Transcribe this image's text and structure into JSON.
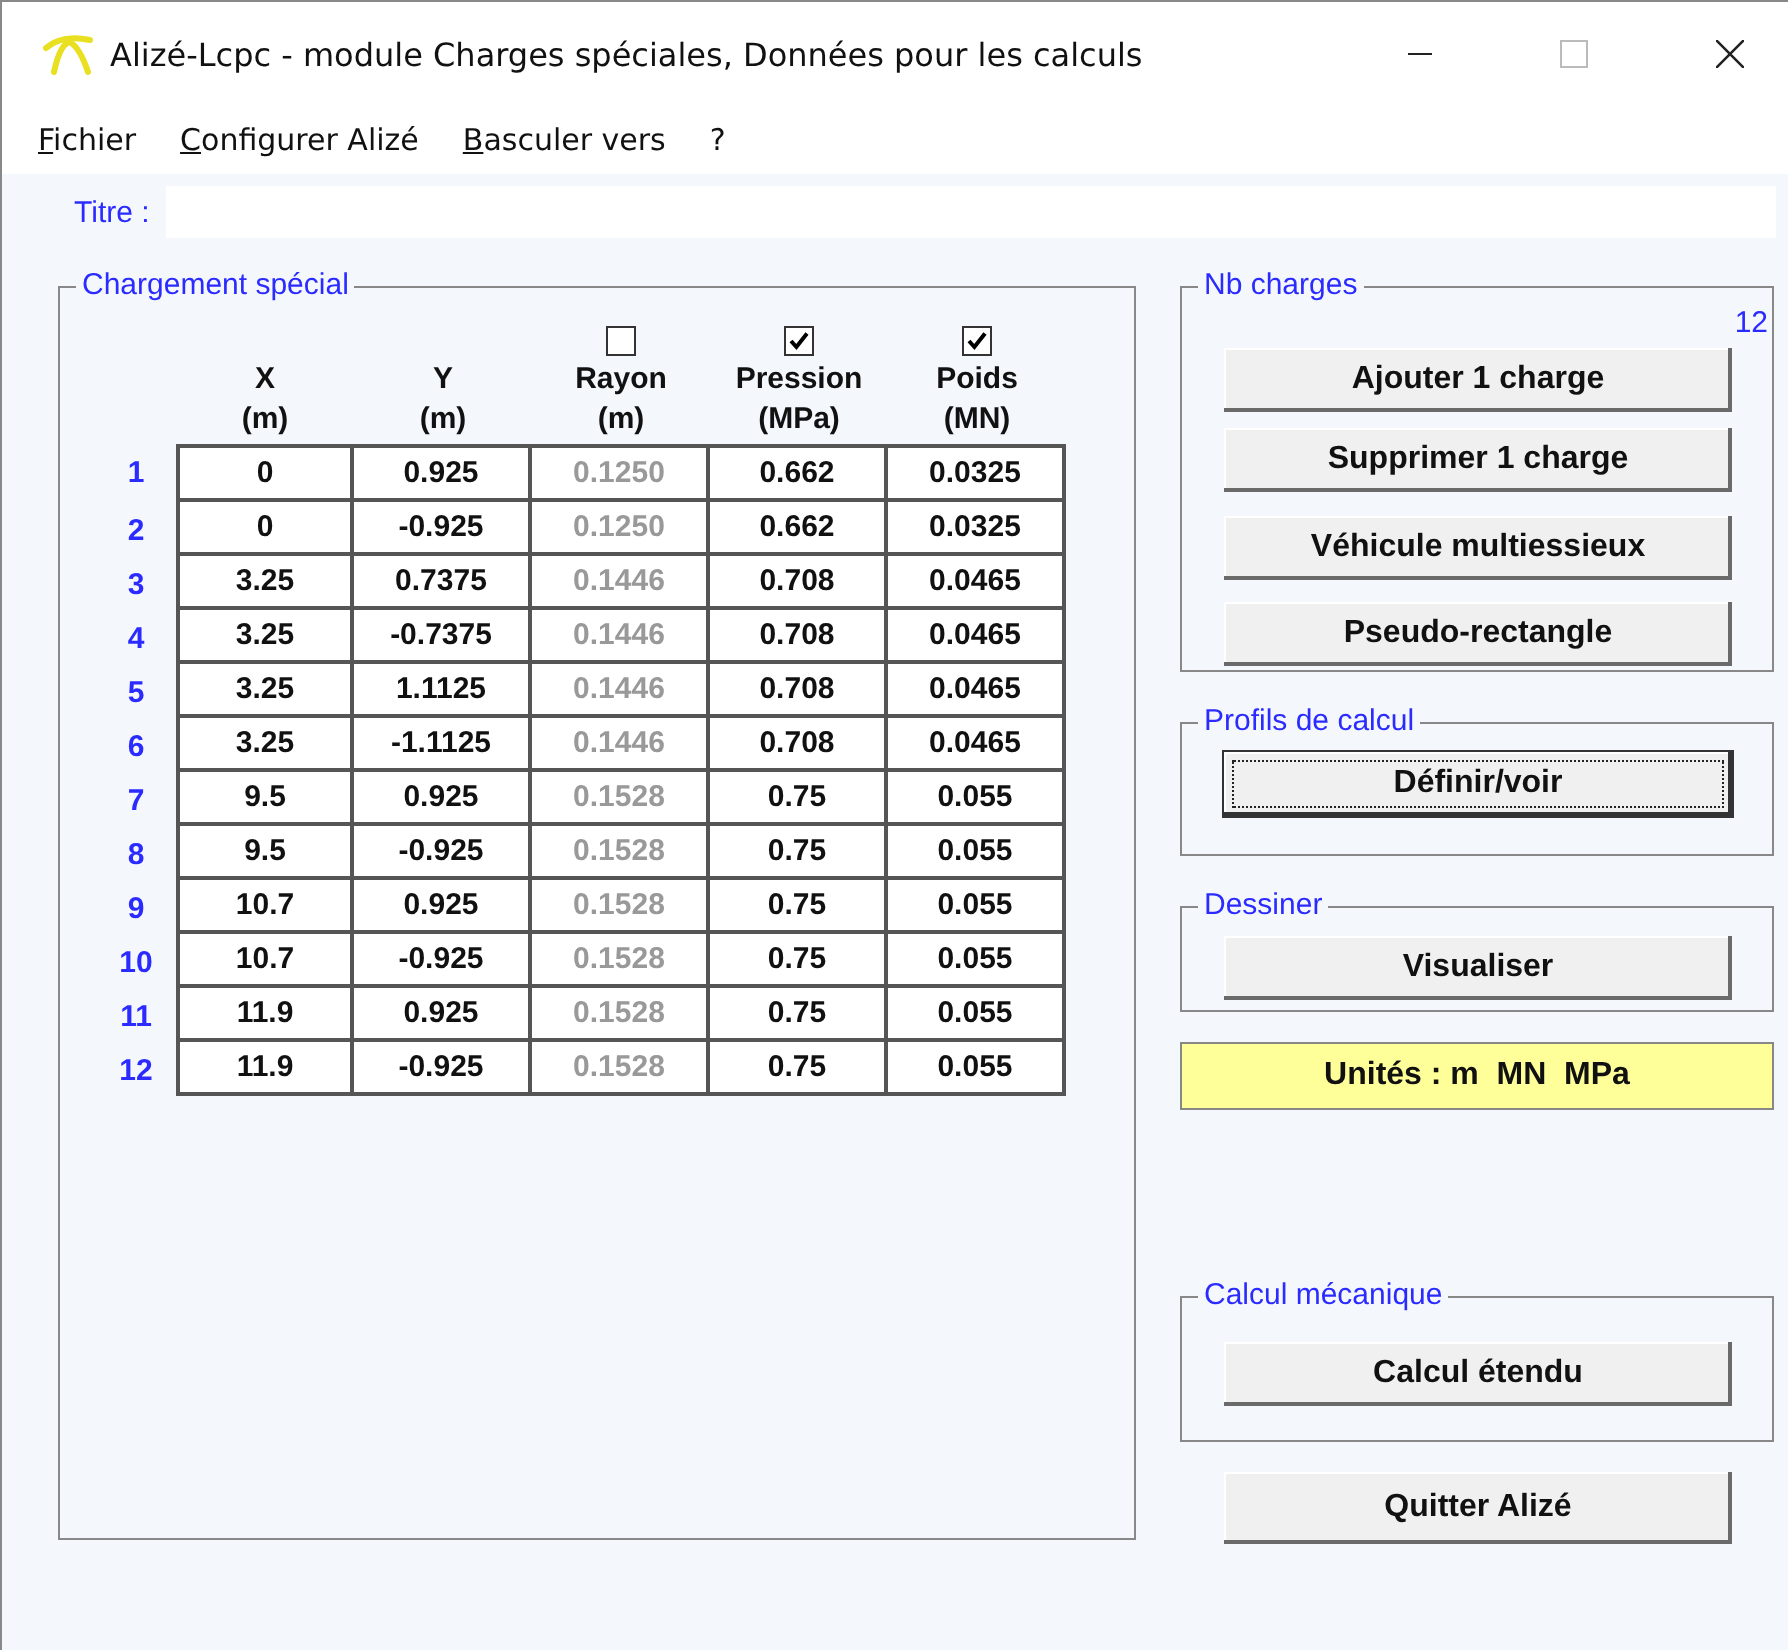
{
  "window": {
    "title": "Alizé-Lcpc - module Charges spéciales, Données pour les calculs"
  },
  "menu": [
    {
      "label": "Fichier",
      "mnemonic": true
    },
    {
      "label": "Configurer Alizé",
      "mnemonic": true
    },
    {
      "label": "Basculer vers",
      "mnemonic": true
    },
    {
      "label": "?",
      "mnemonic": false
    }
  ],
  "titre": {
    "label": "Titre :"
  },
  "chargement": {
    "legend": "Chargement spécial",
    "columns": [
      {
        "name": "X",
        "unit": "(m)"
      },
      {
        "name": "Y",
        "unit": "(m)"
      },
      {
        "name": "Rayon",
        "unit": "(m)",
        "checked": false
      },
      {
        "name": "Pression",
        "unit": "(MPa)",
        "checked": true
      },
      {
        "name": "Poids",
        "unit": "(MN)",
        "checked": true
      }
    ],
    "rows": [
      {
        "index": "1",
        "cells": [
          "0",
          "0.925",
          "0.1250",
          "0.662",
          "0.0325"
        ]
      },
      {
        "index": "2",
        "cells": [
          "0",
          "-0.925",
          "0.1250",
          "0.662",
          "0.0325"
        ]
      },
      {
        "index": "3",
        "cells": [
          "3.25",
          "0.7375",
          "0.1446",
          "0.708",
          "0.0465"
        ]
      },
      {
        "index": "4",
        "cells": [
          "3.25",
          "-0.7375",
          "0.1446",
          "0.708",
          "0.0465"
        ]
      },
      {
        "index": "5",
        "cells": [
          "3.25",
          "1.1125",
          "0.1446",
          "0.708",
          "0.0465"
        ]
      },
      {
        "index": "6",
        "cells": [
          "3.25",
          "-1.1125",
          "0.1446",
          "0.708",
          "0.0465"
        ]
      },
      {
        "index": "7",
        "cells": [
          "9.5",
          "0.925",
          "0.1528",
          "0.75",
          "0.055"
        ]
      },
      {
        "index": "8",
        "cells": [
          "9.5",
          "-0.925",
          "0.1528",
          "0.75",
          "0.055"
        ]
      },
      {
        "index": "9",
        "cells": [
          "10.7",
          "0.925",
          "0.1528",
          "0.75",
          "0.055"
        ]
      },
      {
        "index": "10",
        "cells": [
          "10.7",
          "-0.925",
          "0.1528",
          "0.75",
          "0.055"
        ]
      },
      {
        "index": "11",
        "cells": [
          "11.9",
          "0.925",
          "0.1528",
          "0.75",
          "0.055"
        ]
      },
      {
        "index": "12",
        "cells": [
          "11.9",
          "-0.925",
          "0.1528",
          "0.75",
          "0.055"
        ]
      }
    ]
  },
  "nb_charges": {
    "legend": "Nb charges",
    "count": "12",
    "buttons": [
      {
        "label": "Ajouter 1 charge",
        "focused": false
      },
      {
        "label": "Supprimer 1 charge",
        "focused": false
      },
      {
        "label": "Véhicule multiessieux",
        "focused": false
      },
      {
        "label": "Pseudo-rectangle",
        "focused": false
      }
    ]
  },
  "profils": {
    "legend": "Profils de calcul",
    "button": {
      "label": "Définir/voir",
      "focused": true
    }
  },
  "dessiner": {
    "legend": "Dessiner",
    "button": {
      "label": "Visualiser",
      "focused": false
    }
  },
  "unites": "Unités : m  MN  MPa",
  "calcul": {
    "legend": "Calcul mécanique",
    "button": {
      "label": "Calcul étendu",
      "focused": false
    }
  },
  "quit_button": {
    "label": "Quitter Alizé",
    "focused": false
  }
}
